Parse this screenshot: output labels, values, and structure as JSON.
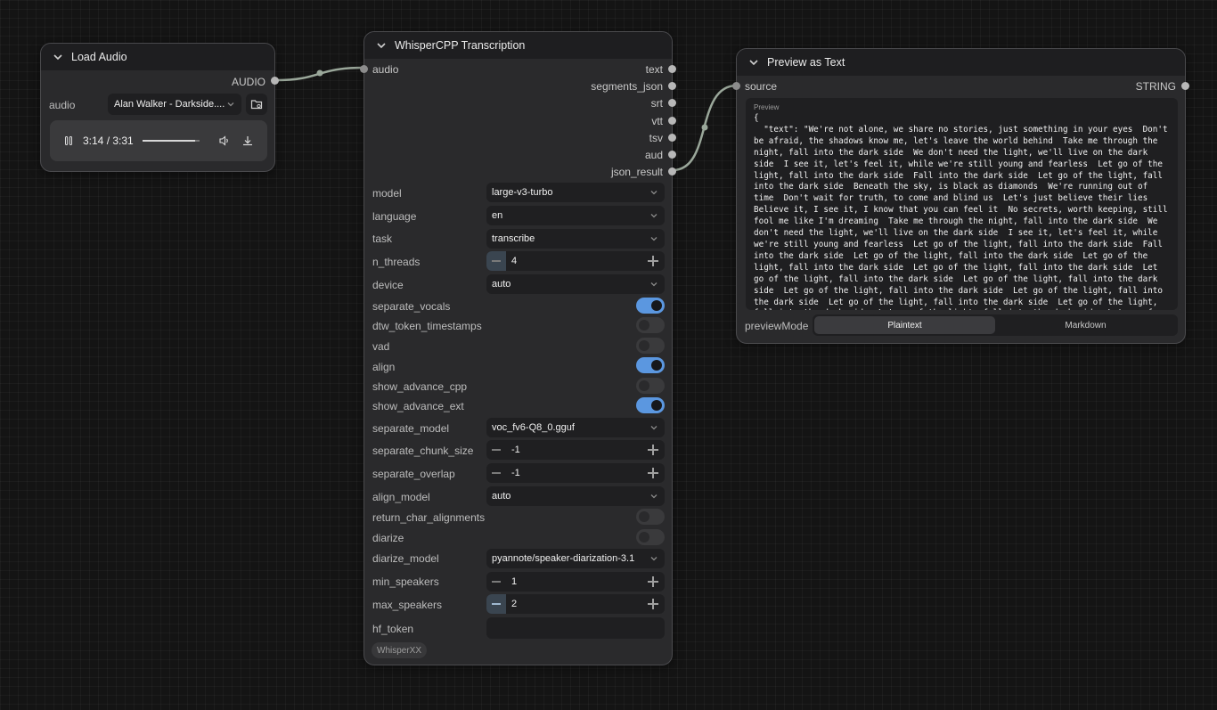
{
  "load_audio": {
    "title": "Load Audio",
    "output_label": "AUDIO",
    "widget_label": "audio",
    "file_value": "Alan Walker - Darkside....",
    "time": "3:14 / 3:31",
    "progress": 0.92
  },
  "whisper": {
    "title": "WhisperCPP Transcription",
    "input_label": "audio",
    "outputs": [
      "text",
      "segments_json",
      "srt",
      "vtt",
      "tsv",
      "aud",
      "json_result"
    ],
    "widgets": {
      "model": {
        "label": "model",
        "value": "large-v3-turbo"
      },
      "language": {
        "label": "language",
        "value": "en"
      },
      "task": {
        "label": "task",
        "value": "transcribe"
      },
      "n_threads": {
        "label": "n_threads",
        "value": "4"
      },
      "device": {
        "label": "device",
        "value": "auto"
      },
      "separate_vocals": {
        "label": "separate_vocals",
        "on": true
      },
      "dtw_token_timestamps": {
        "label": "dtw_token_timestamps",
        "on": false
      },
      "vad": {
        "label": "vad",
        "on": false
      },
      "align": {
        "label": "align",
        "on": true
      },
      "show_advance_cpp": {
        "label": "show_advance_cpp",
        "on": false
      },
      "show_advance_ext": {
        "label": "show_advance_ext",
        "on": true
      },
      "separate_model": {
        "label": "separate_model",
        "value": "voc_fv6-Q8_0.gguf"
      },
      "separate_chunk_size": {
        "label": "separate_chunk_size",
        "value": "-1"
      },
      "separate_overlap": {
        "label": "separate_overlap",
        "value": "-1"
      },
      "align_model": {
        "label": "align_model",
        "value": "auto"
      },
      "return_char_alignments": {
        "label": "return_char_alignments",
        "on": false
      },
      "diarize": {
        "label": "diarize",
        "on": false
      },
      "diarize_model": {
        "label": "diarize_model",
        "value": "pyannote/speaker-diarization-3.1"
      },
      "min_speakers": {
        "label": "min_speakers",
        "value": "1"
      },
      "max_speakers": {
        "label": "max_speakers",
        "value": "2"
      },
      "hf_token": {
        "label": "hf_token",
        "value": ""
      }
    },
    "badge": "WhisperXX"
  },
  "preview": {
    "title": "Preview as Text",
    "input_label": "source",
    "output_label": "STRING",
    "preview_caption": "Preview",
    "text": "{\n  \"text\": \"We're not alone, we share no stories, just something in your eyes  Don't be afraid, the shadows know me, let's leave the world behind  Take me through the night, fall into the dark side  We don't need the light, we'll live on the dark side  I see it, let's feel it, while we're still young and fearless  Let go of the light, fall into the dark side  Fall into the dark side  Let go of the light, fall into the dark side  Beneath the sky, is black as diamonds  We're running out of time  Don't wait for truth, to come and blind us  Let's just believe their lies  Believe it, I see it, I know that you can feel it  No secrets, worth keeping, still fool me like I'm dreaming  Take me through the night, fall into the dark side  We don't need the light, we'll live on the dark side  I see it, let's feel it, while we're still young and fearless  Let go of the light, fall into the dark side  Fall into the dark side  Let go of the light, fall into the dark side  Let go of the light, fall into the dark side  Let go of the light, fall into the dark side  Let go of the light, fall into the dark side  Let go of the light, fall into the dark side  Let go of the light, fall into the dark side  Let go of the light, fall into the dark side  Let go of the light, fall into the dark side  Let go of the light, fall into the dark side  Let go of the light, fall into the dark side  Let go of the light, fall into the dark side  Let go of the light, fall into the dark side  Let",
    "mode_label": "previewMode",
    "modes": [
      "Plaintext",
      "Markdown"
    ],
    "active_mode": "Plaintext"
  }
}
